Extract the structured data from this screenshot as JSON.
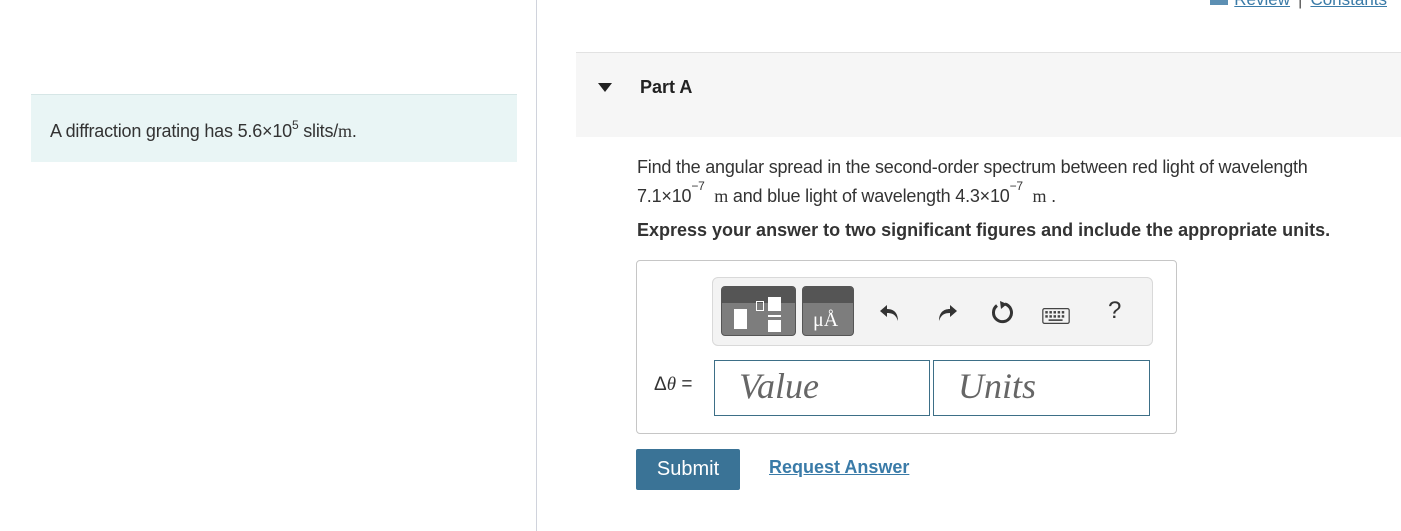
{
  "top_links": {
    "review": "Review",
    "constants": "Constants"
  },
  "problem": {
    "prefix": "A diffraction grating has 5.6×10",
    "exponent": "5",
    "middle": " slits/",
    "unit": "m",
    "suffix": "."
  },
  "part": {
    "title": "Part A"
  },
  "question": {
    "line1": "Find the angular spread in the second-order spectrum between red light of wavelength",
    "red_value": "7.1×10",
    "red_exp": "−7",
    "unit1": "m",
    "mid": "and blue light of wavelength 4.3×10",
    "blue_exp": "−7",
    "unit2": "m",
    "end": "."
  },
  "instructions": "Express your answer to two significant figures and include the appropriate units.",
  "toolbar": {
    "units_glyph": "μÅ",
    "help": "?"
  },
  "answer": {
    "label_delta": "Δ",
    "label_theta": "θ",
    "label_eq": " =",
    "value_placeholder": "Value",
    "units_placeholder": "Units"
  },
  "actions": {
    "submit": "Submit",
    "request_answer": "Request Answer"
  },
  "colors": {
    "accent": "#3a7396",
    "link": "#3a7ba8",
    "problem_bg": "#e9f5f5",
    "field_border": "#3d6f87"
  }
}
